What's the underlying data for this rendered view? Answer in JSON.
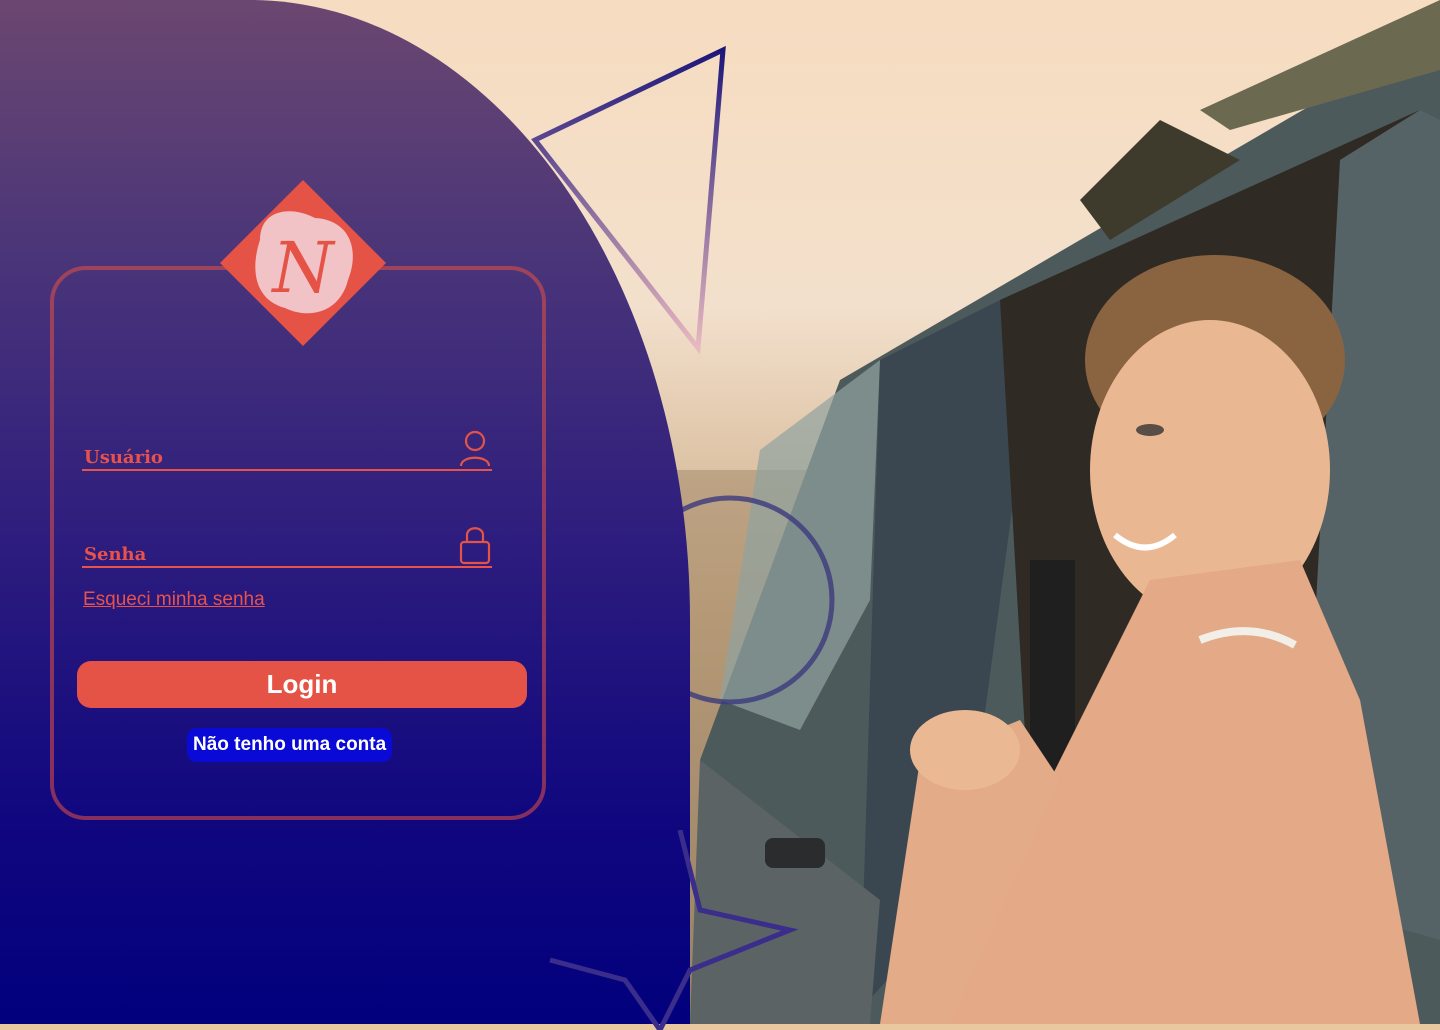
{
  "form": {
    "username_label": "Usuário",
    "password_label": "Senha",
    "forgot_link": "Esqueci minha senha",
    "login_button": "Login",
    "signup_link": "Não tenho uma conta"
  },
  "logo": {
    "letter": "N"
  },
  "icons": {
    "username": "user-icon",
    "password": "lock-icon"
  },
  "colors": {
    "accent": "#e55347",
    "panel_top": "#6b4770",
    "panel_bottom": "#02007d",
    "signup_bg": "#0a0ad6"
  }
}
